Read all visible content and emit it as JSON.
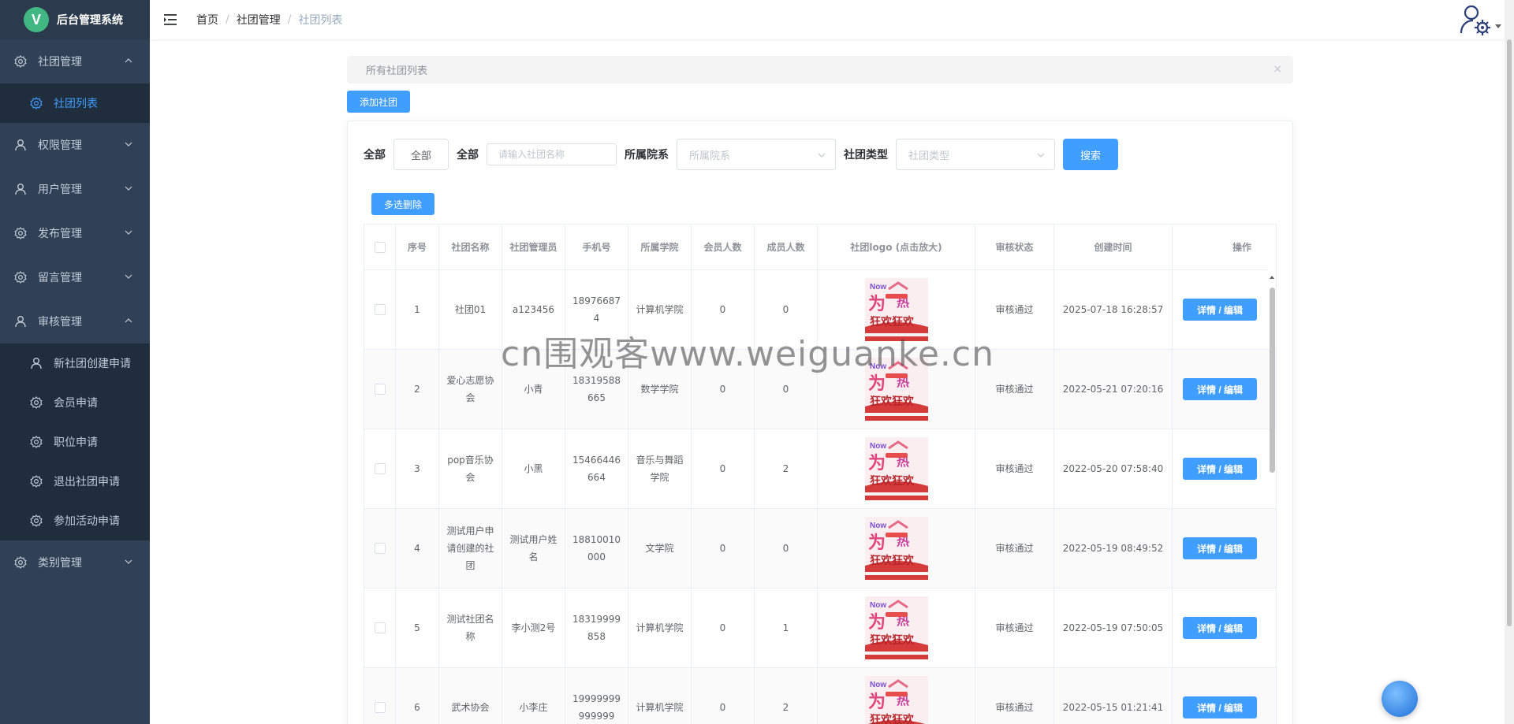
{
  "brand": {
    "logo_letter": "V",
    "title": "后台管理系统",
    "logo_color": "#41b883"
  },
  "sidebar": {
    "items": [
      {
        "label": "社团管理",
        "icon": "gear-icon",
        "expanded": true,
        "children": [
          {
            "label": "社团列表",
            "icon": "gear-icon",
            "active": true
          }
        ]
      },
      {
        "label": "权限管理",
        "icon": "user-icon",
        "expanded": false,
        "children": []
      },
      {
        "label": "用户管理",
        "icon": "user-icon",
        "expanded": false,
        "children": []
      },
      {
        "label": "发布管理",
        "icon": "gear-icon",
        "expanded": false,
        "children": []
      },
      {
        "label": "留言管理",
        "icon": "gear-icon",
        "expanded": false,
        "children": []
      },
      {
        "label": "审核管理",
        "icon": "user-icon",
        "expanded": true,
        "children": [
          {
            "label": "新社团创建申请",
            "icon": "user-icon"
          },
          {
            "label": "会员申请",
            "icon": "gear-icon"
          },
          {
            "label": "职位申请",
            "icon": "gear-icon"
          },
          {
            "label": "退出社团申请",
            "icon": "gear-icon"
          },
          {
            "label": "参加活动申请",
            "icon": "gear-icon"
          }
        ]
      },
      {
        "label": "类别管理",
        "icon": "gear-icon",
        "expanded": false,
        "children": []
      }
    ]
  },
  "header": {
    "breadcrumb": [
      "首页",
      "社团管理",
      "社团列表"
    ],
    "avatar_icon": "user-settings-icon"
  },
  "notice": {
    "text": "所有社团列表",
    "close": "×"
  },
  "toolbar": {
    "add_label": "添加社团",
    "multi_delete_label": "多选删除"
  },
  "search": {
    "label_all_1": "全部",
    "all_button": "全部",
    "label_all_2": "全部",
    "name_placeholder": "请输入社团名称",
    "college_label": "所属院系",
    "college_placeholder": "所属院系",
    "type_label": "社团类型",
    "type_placeholder": "社团类型",
    "search_button": "搜索"
  },
  "table": {
    "columns": [
      "序号",
      "社团名称",
      "社团管理员",
      "手机号",
      "所属学院",
      "会员人数",
      "成员人数",
      "社团logo (点击放大)",
      "审核状态",
      "创建时间",
      "操作"
    ],
    "action_label": "详情 / 编辑",
    "rows": [
      {
        "index": "1",
        "name": "社团01",
        "admin": "a123456",
        "phone": "189766874",
        "college": "计算机学院",
        "members": "0",
        "staff": "0",
        "status": "审核通过",
        "created": "2025-07-18 16:28:57"
      },
      {
        "index": "2",
        "name": "爱心志愿协会",
        "admin": "小青",
        "phone": "18319588665",
        "college": "数学学院",
        "members": "0",
        "staff": "0",
        "status": "审核通过",
        "created": "2022-05-21 07:20:16"
      },
      {
        "index": "3",
        "name": "pop音乐协会",
        "admin": "小黑",
        "phone": "15466446664",
        "college": "音乐与舞蹈学院",
        "members": "0",
        "staff": "2",
        "status": "审核通过",
        "created": "2022-05-20 07:58:40"
      },
      {
        "index": "4",
        "name": "测试用户申请创建的社团",
        "admin": "测试用户姓名",
        "phone": "18810010000",
        "college": "文学院",
        "members": "0",
        "staff": "0",
        "status": "审核通过",
        "created": "2022-05-19 08:49:52"
      },
      {
        "index": "5",
        "name": "测试社团名称",
        "admin": "李小测2号",
        "phone": "18319999858",
        "college": "计算机学院",
        "members": "0",
        "staff": "1",
        "status": "审核通过",
        "created": "2022-05-19 07:50:05"
      },
      {
        "index": "6",
        "name": "武术协会",
        "admin": "小李庄",
        "phone": "19999999999999",
        "college": "计算机学院",
        "members": "0",
        "staff": "2",
        "status": "审核通过",
        "created": "2022-05-15 01:21:41"
      }
    ]
  },
  "watermark": "cn围观客www.weiguanke.cn",
  "colors": {
    "sidebar_bg": "#304156",
    "submenu_bg": "#1f2d3d",
    "primary": "#409eff"
  }
}
